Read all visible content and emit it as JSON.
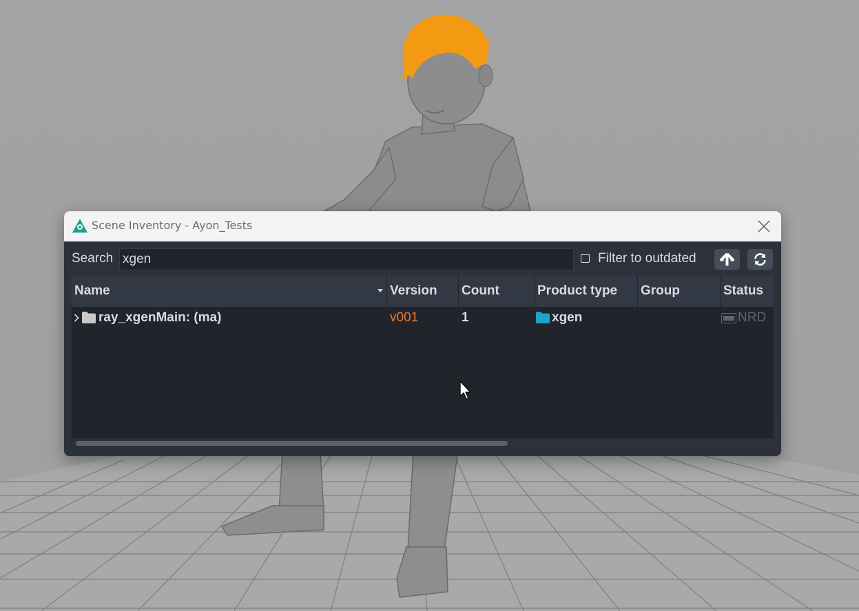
{
  "window": {
    "title": "Scene Inventory - Ayon_Tests",
    "app_icon": "ayon-logo-icon",
    "close_icon": "close-icon"
  },
  "toolbar": {
    "search_label": "Search",
    "search_value": "xgen",
    "filter_label": "Filter to outdated",
    "filter_checked": false,
    "up_icon": "arrow-up-icon",
    "refresh_icon": "refresh-icon"
  },
  "table": {
    "columns": [
      "Name",
      "Version",
      "Count",
      "Product type",
      "Group",
      "Status"
    ],
    "rows": [
      {
        "name": "ray_xgenMain: (ma)",
        "version": "v001",
        "count": "1",
        "product_type": "xgen",
        "group": "",
        "status": "NRD"
      }
    ]
  },
  "colors": {
    "window_bg": "#2c313a",
    "table_bg": "#21252b",
    "header_bg": "#323844",
    "text": "#d8dce2",
    "version_outdated": "#e87b31",
    "product_folder": "#1fa4c6",
    "status_muted": "#5e6570",
    "hair": "#f39a12"
  }
}
